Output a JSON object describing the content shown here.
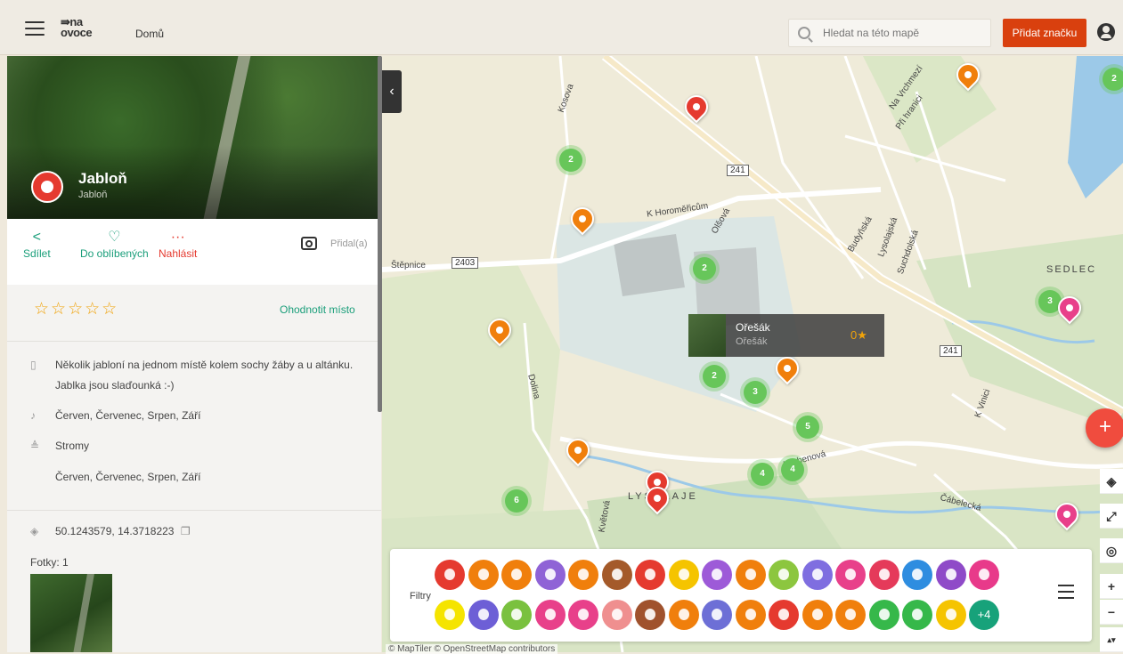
{
  "header": {
    "logo_line1": "⇛na",
    "logo_line2": "ovoce",
    "home": "Domů",
    "search_placeholder": "Hledat na této mapě",
    "add_button": "Přidat značku"
  },
  "place": {
    "title": "Jabloň",
    "subtitle": "Jabloň",
    "actions": {
      "share": "Sdílet",
      "favorite": "Do oblíbených",
      "report": "Nahlásit",
      "added_by": "Přidal(a)"
    },
    "rating_stars": "☆☆☆☆☆",
    "rate_link": "Ohodnotit místo",
    "description_line1": "Několik jabloní na jednom místě kolem sochy žáby a u altánku.",
    "description_line2": "Jablka jsou slaďounká :-)",
    "season": "Červen, Červenec, Srpen, Září",
    "type": "Stromy",
    "season2": "Červen, Červenec, Srpen, Září",
    "coordinates": "50.1243579, 14.3718223",
    "photos_label": "Fotky: 1"
  },
  "map": {
    "popup": {
      "title": "Ořešák",
      "subtitle": "Ořešák",
      "rating": "0★"
    },
    "labels": {
      "stepnice": "Štěpnice",
      "road2403": "2403",
      "road241a": "241",
      "road241b": "241",
      "horomericum": "K Horoměřicům",
      "kosova": "Kosova",
      "olsova": "Olšová",
      "budynska": "Budyňská",
      "lysolajska": "Lysolajská",
      "suchdolska": "Suchdolská",
      "navrchmezi": "Na Vrchmezí",
      "prihranici": "Při hranici",
      "sedlec": "SEDLEC",
      "dolina": "Dolina",
      "lysolaje": "LYSOLAJE",
      "kvetova": "Květová",
      "hrebenova": "Hřebenová",
      "cabelecka": "Čábelecká",
      "kvinici": "K Vinici",
      "credits": "© MapTiler © OpenStreetMap contributors"
    },
    "clusters": [
      "2",
      "2",
      "2",
      "3",
      "4",
      "4",
      "5",
      "6",
      "3",
      "2"
    ],
    "fab": "+",
    "controls": [
      "◈",
      "⤢",
      "◎",
      "+",
      "−",
      "▴▾"
    ]
  },
  "filters": {
    "label": "Filtry",
    "more": "+4",
    "row1_colors": [
      "#e53a2f",
      "#f07f0c",
      "#f07f0c",
      "#8f63d6",
      "#f07f0c",
      "#a45a2a",
      "#e53a2f",
      "#f5c400",
      "#9d5ad8",
      "#f07f0c",
      "#8cc63f",
      "#7f6ee0",
      "#e8408a",
      "#e53a5a",
      "#2e8de0",
      "#8f4ac8",
      "#e83a8a"
    ],
    "row2_colors": [
      "#f5e400",
      "#6d5fd6",
      "#7ac13f",
      "#e8408a",
      "#e8408a",
      "#ef8f8f",
      "#a0522d",
      "#f07f0c",
      "#6d6fd6",
      "#f07f0c",
      "#e53a2f",
      "#f07f0c",
      "#f07f0c",
      "#36b84a",
      "#36b84a",
      "#f5c400",
      "#17a27a"
    ]
  }
}
